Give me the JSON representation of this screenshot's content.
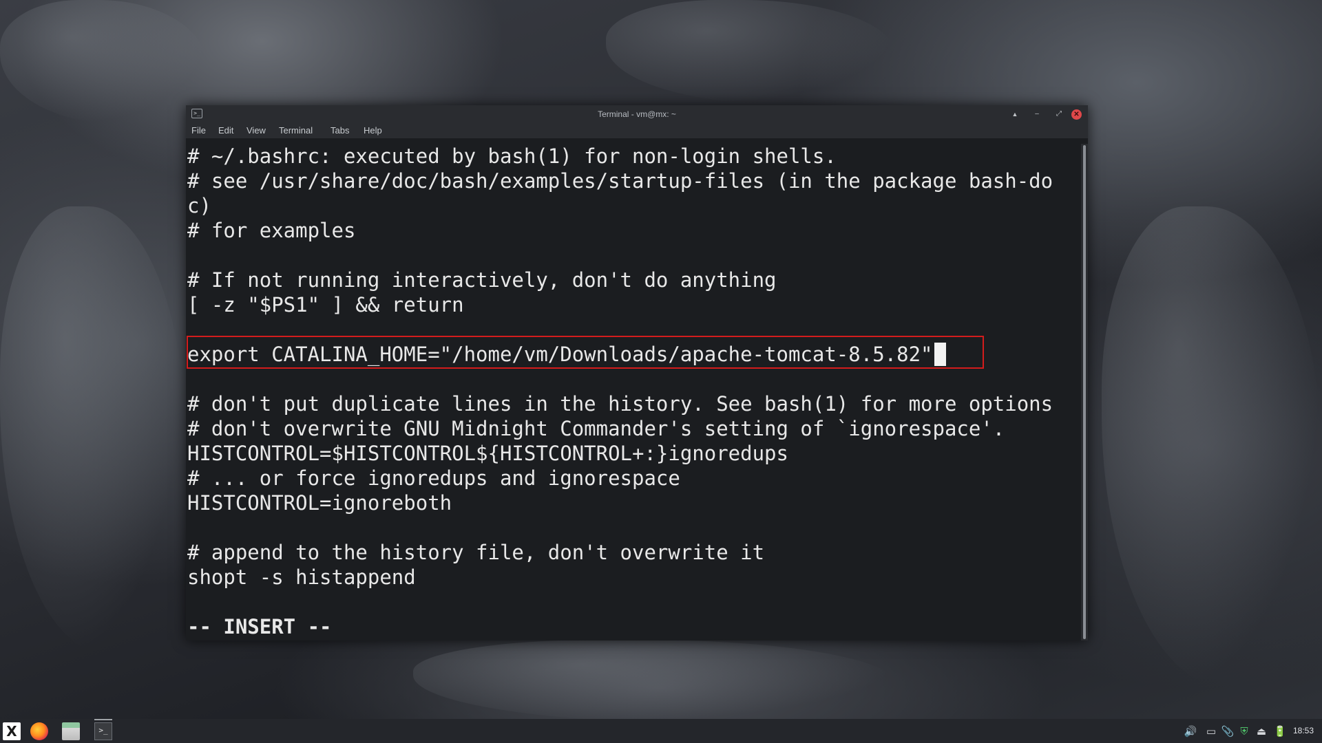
{
  "window": {
    "title": "Terminal - vm@mx: ~",
    "app_icon": ">_",
    "buttons": {
      "shade": "▲",
      "minimize": "–",
      "maximize": "⤢",
      "close": "✕"
    }
  },
  "menu": [
    "File",
    "Edit",
    "View",
    "Terminal",
    "Tabs",
    "Help"
  ],
  "terminal": {
    "lines": [
      "# ~/.bashrc: executed by bash(1) for non-login shells.",
      "# see /usr/share/doc/bash/examples/startup-files (in the package bash-do",
      "c)",
      "# for examples",
      "",
      "# If not running interactively, don't do anything",
      "[ -z \"$PS1\" ] && return",
      "",
      "export CATALINA_HOME=\"/home/vm/Downloads/apache-tomcat-8.5.82\"",
      "",
      "# don't put duplicate lines in the history. See bash(1) for more options",
      "# don't overwrite GNU Midnight Commander's setting of `ignorespace'.",
      "HISTCONTROL=$HISTCONTROL${HISTCONTROL+:}ignoredups",
      "# ... or force ignoredups and ignorespace",
      "HISTCONTROL=ignoreboth",
      "",
      "# append to the history file, don't overwrite it",
      "shopt -s histappend",
      ""
    ],
    "mode": "-- INSERT --",
    "highlight_color": "#d41c1c"
  },
  "taskbar": {
    "start_logo": "X",
    "apps": [
      "firefox-icon",
      "files-icon",
      "terminal-icon"
    ],
    "terminal_task_glyph": ">_",
    "tray": {
      "volume": "🔊",
      "display": "▭",
      "clip": "📎",
      "shield": "⛨",
      "eject": "⏏",
      "battery": "🔋"
    },
    "clock": "18:53"
  }
}
